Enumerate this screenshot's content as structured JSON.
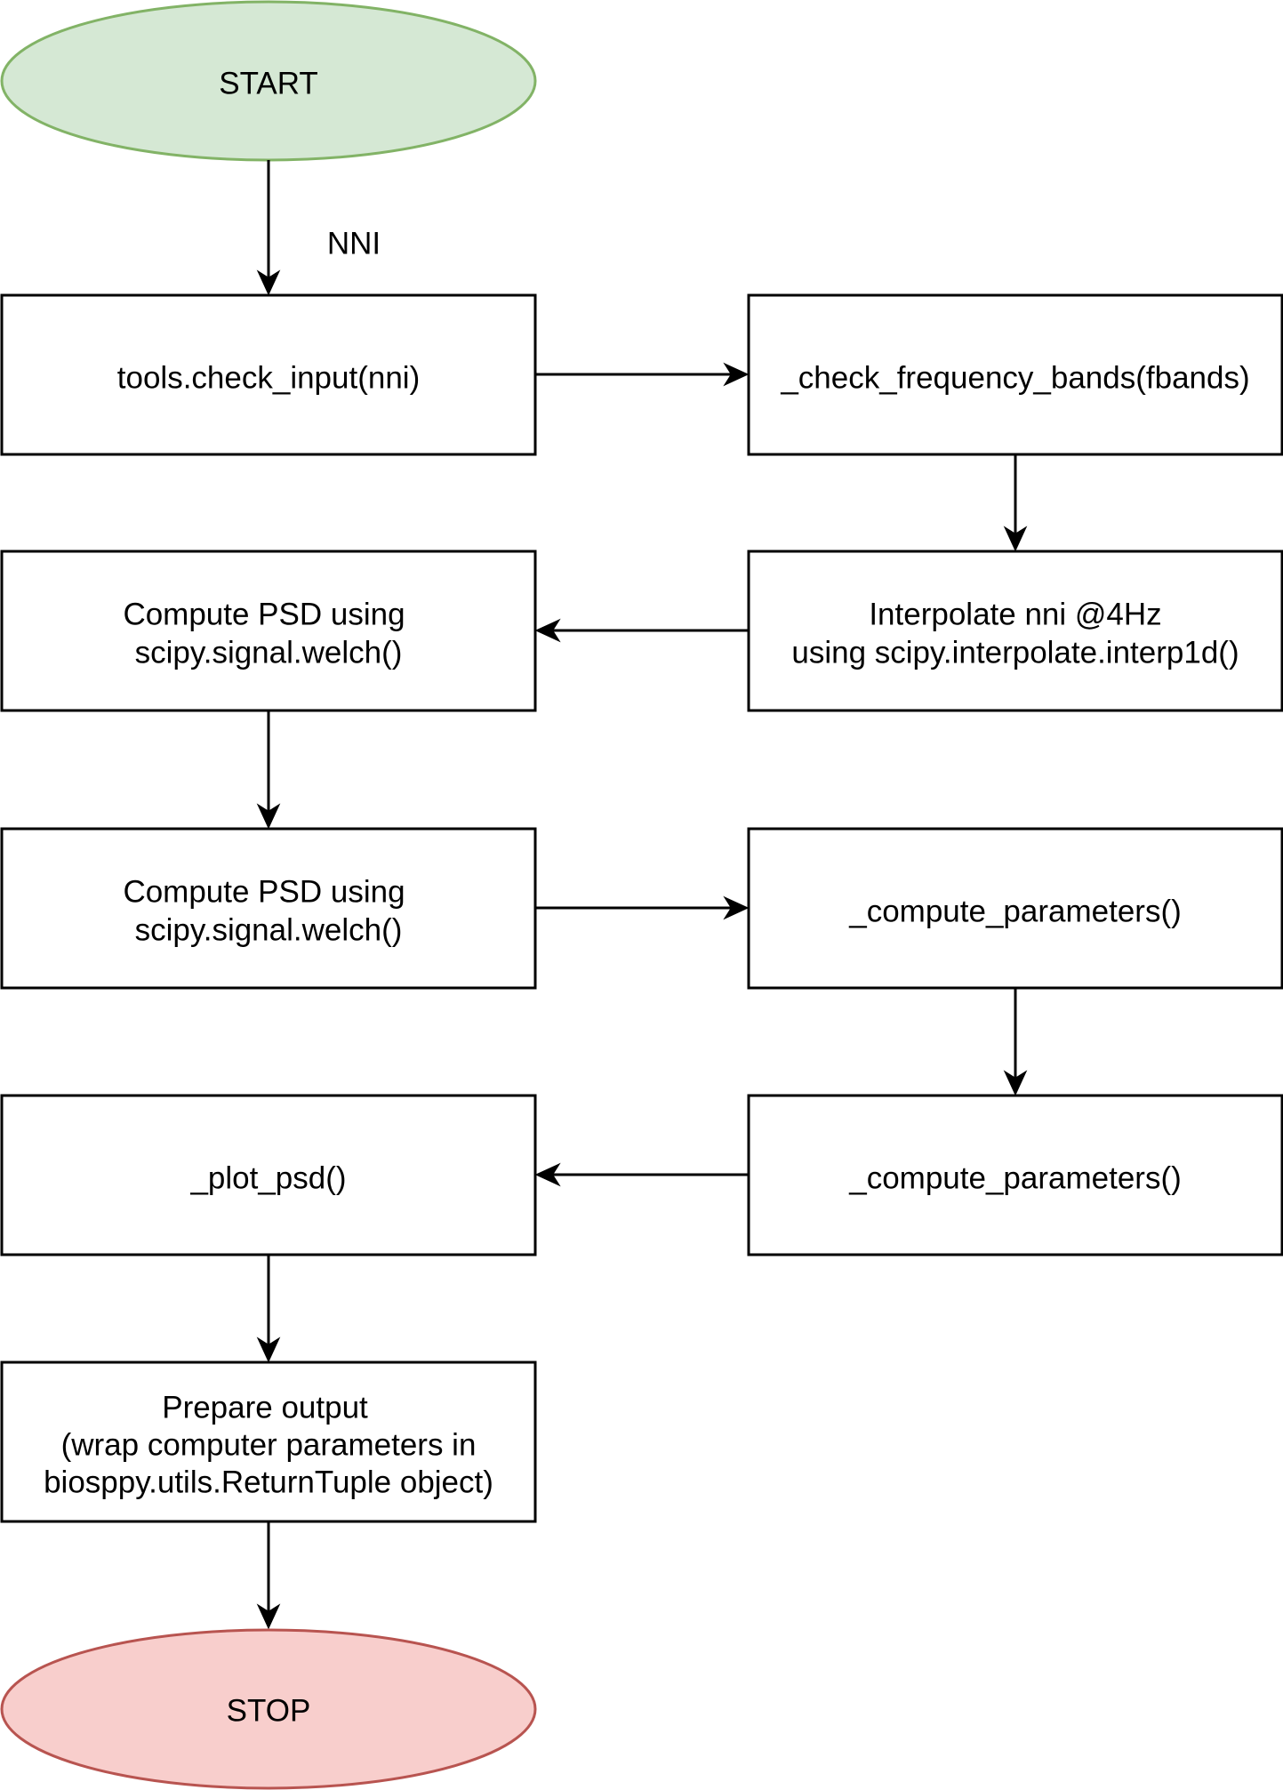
{
  "diagram": {
    "colors": {
      "start_fill": "#d5e8d4",
      "start_stroke": "#82b366",
      "stop_fill": "#f8cecc",
      "stop_stroke": "#b85450",
      "box_fill": "#ffffff",
      "line": "#000000"
    },
    "start": {
      "label": "START"
    },
    "edge_label_nni": "NNI",
    "check_input": {
      "label": "tools.check_input(nni)"
    },
    "check_bands": {
      "label": "_check_frequency_bands(fbands)"
    },
    "interpolate": {
      "line1": "Interpolate nni @4Hz",
      "line2": "using scipy.interpolate.interp1d()"
    },
    "psd_1": {
      "line1": "Compute PSD using",
      "line2": "scipy.signal.welch()"
    },
    "psd_2": {
      "line1": "Compute PSD using",
      "line2": "scipy.signal.welch()"
    },
    "params_1": {
      "label": "_compute_parameters()"
    },
    "params_2": {
      "label": "_compute_parameters()"
    },
    "plot_psd": {
      "label": "_plot_psd()"
    },
    "output": {
      "line1": "Prepare output",
      "line2": "(wrap computer parameters in",
      "line3": "biosppy.utils.ReturnTuple object)"
    },
    "stop": {
      "label": "STOP"
    }
  }
}
